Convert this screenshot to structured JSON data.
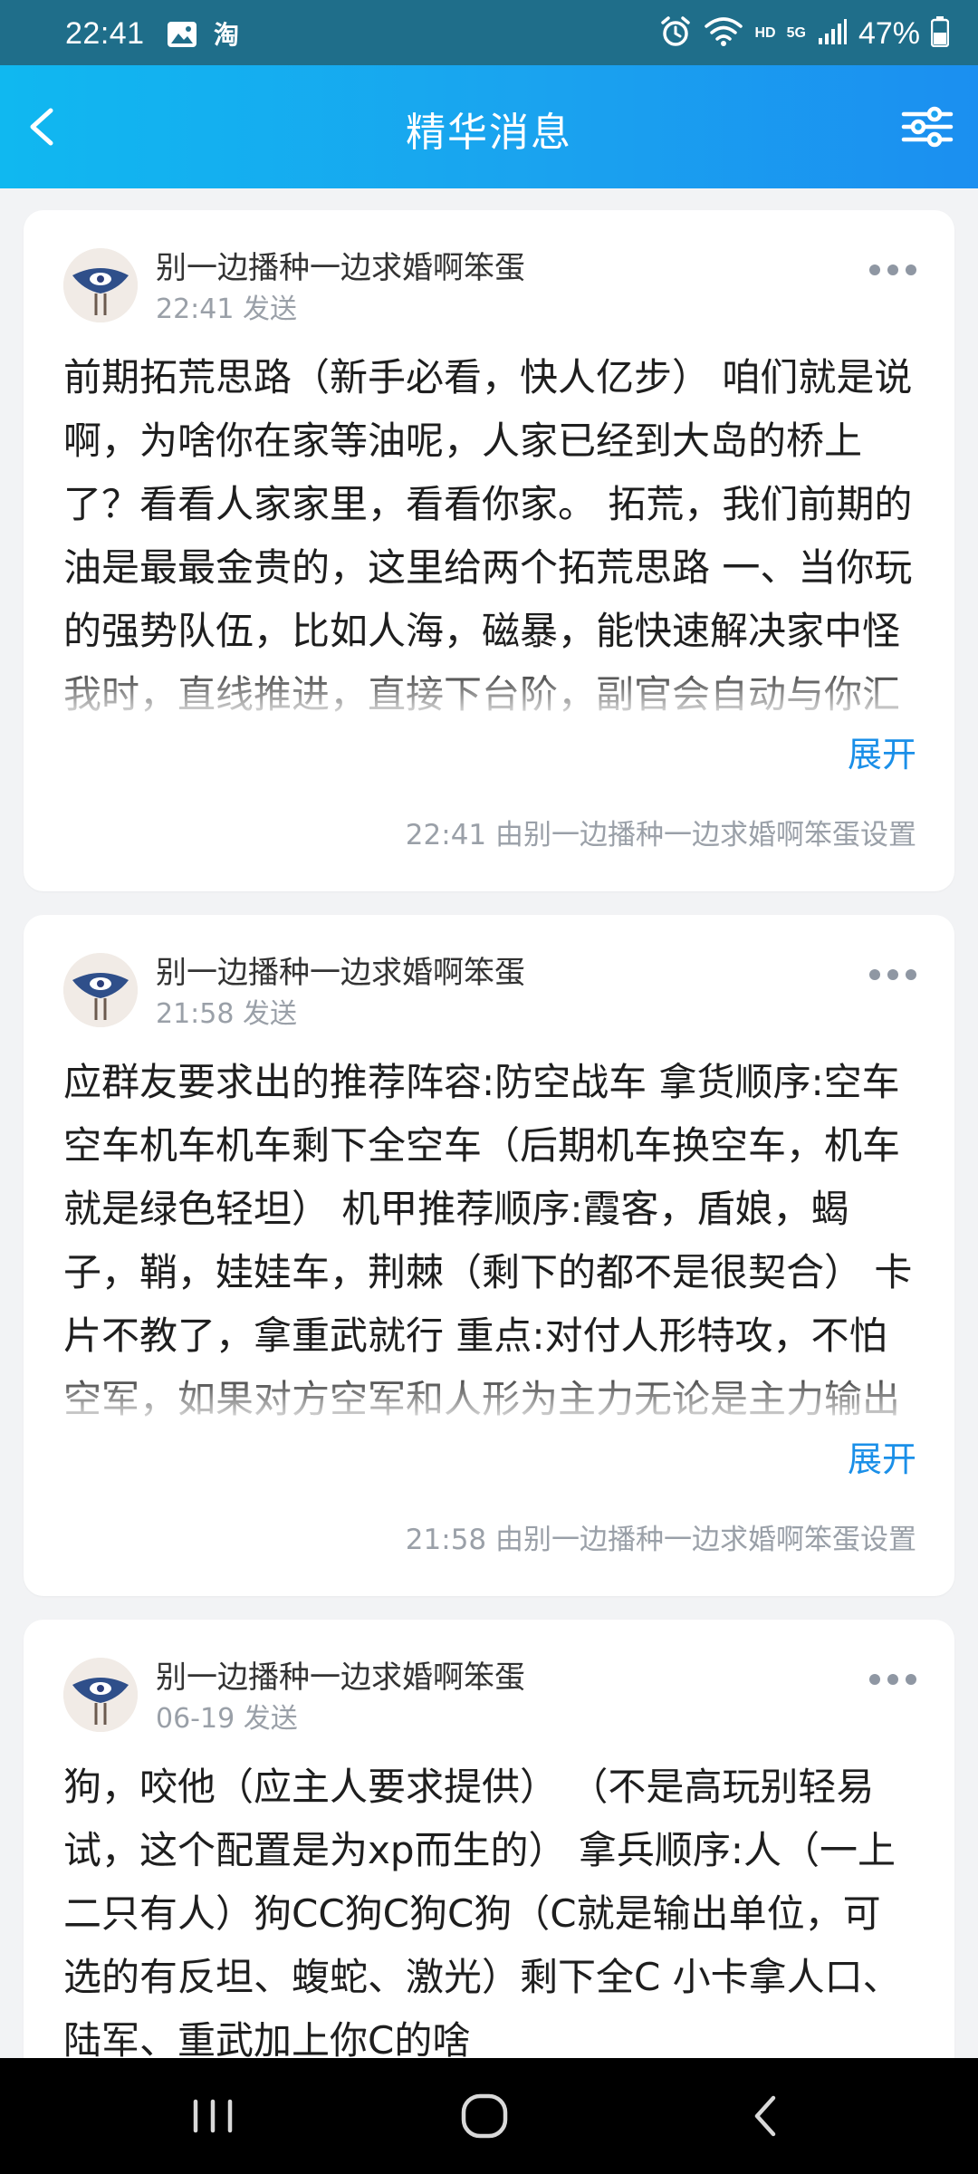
{
  "status_bar": {
    "time": "22:41",
    "network_hd": "HD",
    "network_5g": "5G",
    "battery": "47%"
  },
  "header": {
    "title": "精华消息"
  },
  "colors": {
    "accent": "#1a8fe8",
    "header_gradient_start": "#10b8f0",
    "header_gradient_end": "#1b8ff0"
  },
  "posts": [
    {
      "author": "别一边播种一边求婚啊笨蛋",
      "sent": "22:41 发送",
      "content": "前期拓荒思路（新手必看，快人亿步） 咱们就是说啊，为啥你在家等油呢，人家已经到大岛的桥上了？看看人家家里，看看你家。 拓荒，我们前期的油是最最金贵的，这里给两个拓荒思路 一、当你玩的强势队伍，比如人海，磁暴，能快速解决家中怪我时，直线推进，直接下台阶，副官会自动与你汇合，二",
      "expand": "展开",
      "footer": "22:41 由别一边播种一边求婚啊笨蛋设置"
    },
    {
      "author": "别一边播种一边求婚啊笨蛋",
      "sent": "21:58 发送",
      "content": "应群友要求出的推荐阵容:防空战车 拿货顺序:空车空车机车机车剩下全空车（后期机车换空车，机车就是绿色轻坦） 机甲推荐顺序:霞客，盾娘，蝎子，鞘，娃娃车，荆棘（剩下的都不是很契合） 卡片不教了，拿重武就行 重点:对付人形特攻，不怕空军，如果对方空军和人形为主力无论是主力输出还是肉都很扎",
      "expand": "展开",
      "footer": "21:58 由别一边播种一边求婚啊笨蛋设置"
    },
    {
      "author": "别一边播种一边求婚啊笨蛋",
      "sent": "06-19 发送",
      "content": "狗，咬他（应主人要求提供） （不是高玩别轻易试，这个配置是为xp而生的） 拿兵顺序:人（一上二只有人）狗CC狗C狗C狗（C就是输出单位，可选的有反坦、蝮蛇、激光）剩下全C 小卡拿人口、陆军、重武加上你C的啥"
    }
  ]
}
